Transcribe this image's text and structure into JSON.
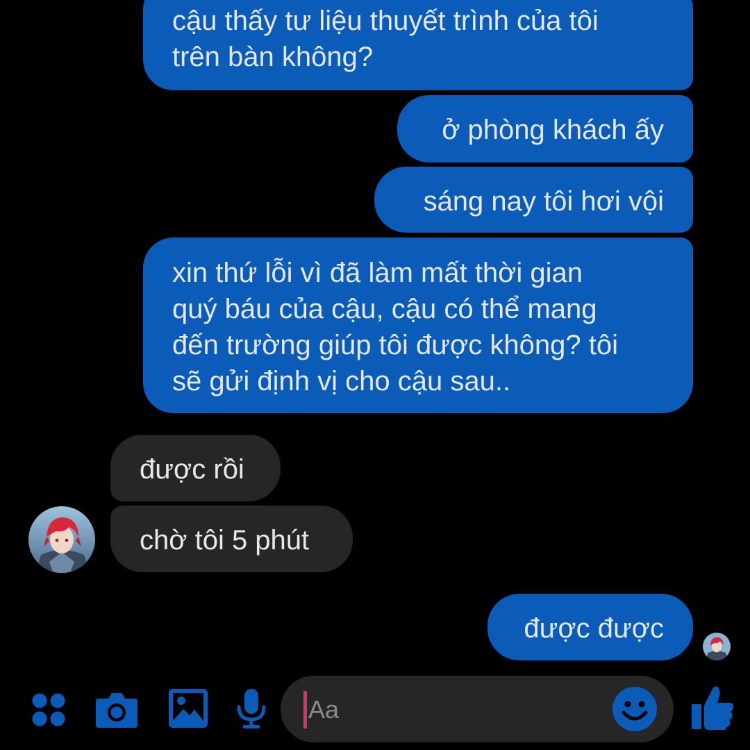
{
  "colors": {
    "background": "#000000",
    "sent_bubble": "#0a5cb8",
    "received_bubble": "#262626",
    "accent": "#0a5cb8",
    "caret": "#d6336c"
  },
  "messages": [
    {
      "direction": "sent",
      "text": "cậu thấy tư liệu thuyết trình của tôi\ntrên bàn không?"
    },
    {
      "direction": "sent",
      "text": "ở phòng khách ấy"
    },
    {
      "direction": "sent",
      "text": "sáng nay tôi hơi vội"
    },
    {
      "direction": "sent",
      "text": "xin thứ lỗi vì đã làm mất thời gian\nquý báu của cậu, cậu có thể mang\nđến trường giúp tôi được không? tôi\nsẽ gửi định vị cho cậu sau.."
    },
    {
      "direction": "received",
      "text": "được rồi"
    },
    {
      "direction": "received",
      "text": "chờ tôi 5 phút"
    },
    {
      "direction": "sent",
      "text": "được được"
    }
  ],
  "composer": {
    "placeholder": "Aa"
  },
  "toolbar": {
    "icons": [
      "apps-icon",
      "camera-icon",
      "image-icon",
      "mic-icon",
      "emoji-icon",
      "like-icon"
    ]
  }
}
